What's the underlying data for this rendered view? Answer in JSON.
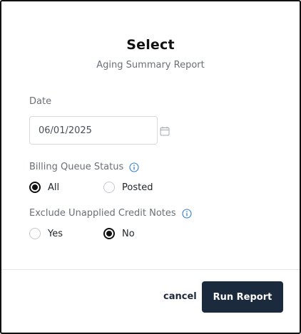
{
  "dialog": {
    "title": "Select",
    "subtitle": "Aging Summary Report"
  },
  "date_field": {
    "label": "Date",
    "value": "06/01/2025",
    "icon": "calendar-icon"
  },
  "billing_queue_status": {
    "label": "Billing Queue Status",
    "info_icon": "info-icon",
    "options": [
      {
        "label": "All",
        "selected": true
      },
      {
        "label": "Posted",
        "selected": false
      }
    ]
  },
  "exclude_unapplied_credit_notes": {
    "label": "Exclude Unapplied Credit Notes",
    "info_icon": "info-icon",
    "options": [
      {
        "label": "Yes",
        "selected": false
      },
      {
        "label": "No",
        "selected": true
      }
    ]
  },
  "footer": {
    "cancel_label": "cancel",
    "run_label": "Run Report"
  },
  "colors": {
    "primary_button": "#1c2a3e",
    "info_icon": "#2f7fd6",
    "radio_checked": "#111111"
  }
}
